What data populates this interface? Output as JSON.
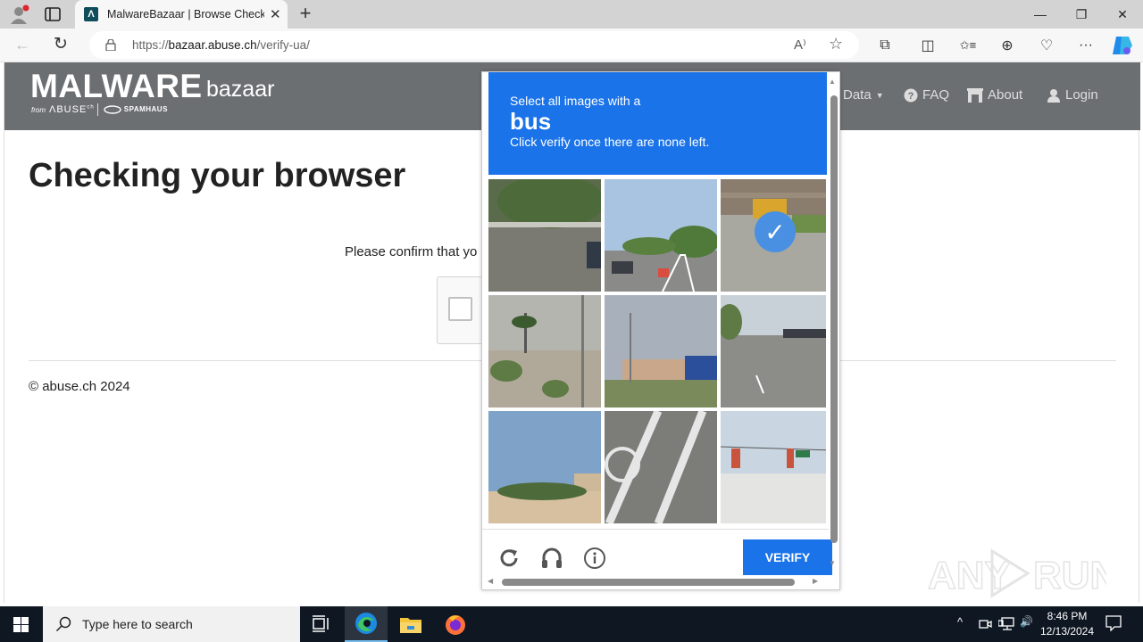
{
  "browser": {
    "tab_title": "MalwareBazaar | Browse Checking your browser",
    "tab_favicon": "Λ",
    "url_prefix": "https://",
    "url_host": "bazaar.abuse.ch",
    "url_path": "/verify-ua/",
    "new_tab": "+",
    "icons": {
      "back": "←",
      "reload": "↻",
      "read_aloud": "A⁾",
      "favorite": "☆",
      "extensions": "⧉",
      "split": "◫",
      "favorites": "✩≡",
      "collections": "⊕",
      "health": "♡",
      "more": "···"
    },
    "window": {
      "minimize": "—",
      "restore": "❐",
      "close": "✕"
    }
  },
  "site": {
    "logo_main": "MALWARE",
    "logo_sub": "bazaar",
    "logo_from": "from",
    "logo_abuse": "ΛBUSE",
    "logo_abuse_sup": "ch",
    "logo_spamhaus": "SPAMHAUS",
    "nav": [
      {
        "label": "Data",
        "icon": "caret-down"
      },
      {
        "label": "FAQ",
        "icon": "question-circle"
      },
      {
        "label": "About",
        "icon": "building"
      },
      {
        "label": "Login",
        "icon": "user"
      }
    ],
    "heading": "Checking your browser",
    "confirm_text": "Please confirm that yo",
    "copyright": "© abuse.ch 2024"
  },
  "captcha": {
    "instruction_line1": "Select all images with a",
    "target_object": "bus",
    "instruction_line3": "Click verify once there are none left.",
    "verify_label": "VERIFY",
    "tiles": [
      {
        "desc": "tree-lined street with parked car",
        "selected": false
      },
      {
        "desc": "multi-lane road with red car",
        "selected": false
      },
      {
        "desc": "school bus at intersection",
        "selected": true
      },
      {
        "desc": "palm tree and wall",
        "selected": false
      },
      {
        "desc": "building with blue roof",
        "selected": false
      },
      {
        "desc": "road with cars",
        "selected": false
      },
      {
        "desc": "shrubs and building",
        "selected": false
      },
      {
        "desc": "bike lane markings",
        "selected": false
      },
      {
        "desc": "traffic lights and street sign",
        "selected": false
      }
    ],
    "selected_icon": "✓"
  },
  "watermark": "ANY RUN",
  "taskbar": {
    "search_placeholder": "Type here to search",
    "time": "8:46 PM",
    "date": "12/13/2024",
    "tray_chevron": "^",
    "tray_volume": "🔊"
  }
}
